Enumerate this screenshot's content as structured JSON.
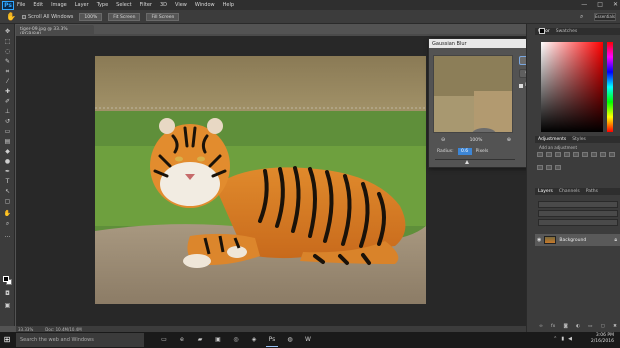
{
  "app": {
    "logo": "Ps",
    "menu": [
      "File",
      "Edit",
      "Image",
      "Layer",
      "Type",
      "Select",
      "Filter",
      "3D",
      "View",
      "Window",
      "Help"
    ],
    "window_controls": [
      "—",
      "□",
      "✕"
    ]
  },
  "options_bar": {
    "scroll_all_label": "Scroll All Windows",
    "zoom_label": "100%",
    "fit_screen_label": "Fit Screen",
    "fill_screen_label": "Fill Screen",
    "workspace_label": "Essentials"
  },
  "document": {
    "tab_title": "tiger-09.jpg @ 33.3% (RGB/8#)",
    "status_zoom": "33.33%",
    "status_doc": "Doc: 10.4M/10.4M"
  },
  "dialog": {
    "title": "Gaussian Blur",
    "ok_label": "OK",
    "cancel_label": "Cancel",
    "preview_label": "Preview",
    "preview_checked": true,
    "zoom_percent": "100%",
    "radius_label": "Radius:",
    "radius_value": "0.6",
    "unit_label": "Pixels"
  },
  "panels": {
    "color_tabs": [
      "Color",
      "Swatches"
    ],
    "adjust_tabs": [
      "Adjustments",
      "Styles"
    ],
    "adjust_header": "Add an adjustment",
    "layers_tabs": [
      "Layers",
      "Channels",
      "Paths"
    ],
    "layer_name": "Background"
  },
  "taskbar": {
    "search_placeholder": "Search the web and Windows",
    "time": "3:06 PM",
    "date": "2/16/2016"
  }
}
